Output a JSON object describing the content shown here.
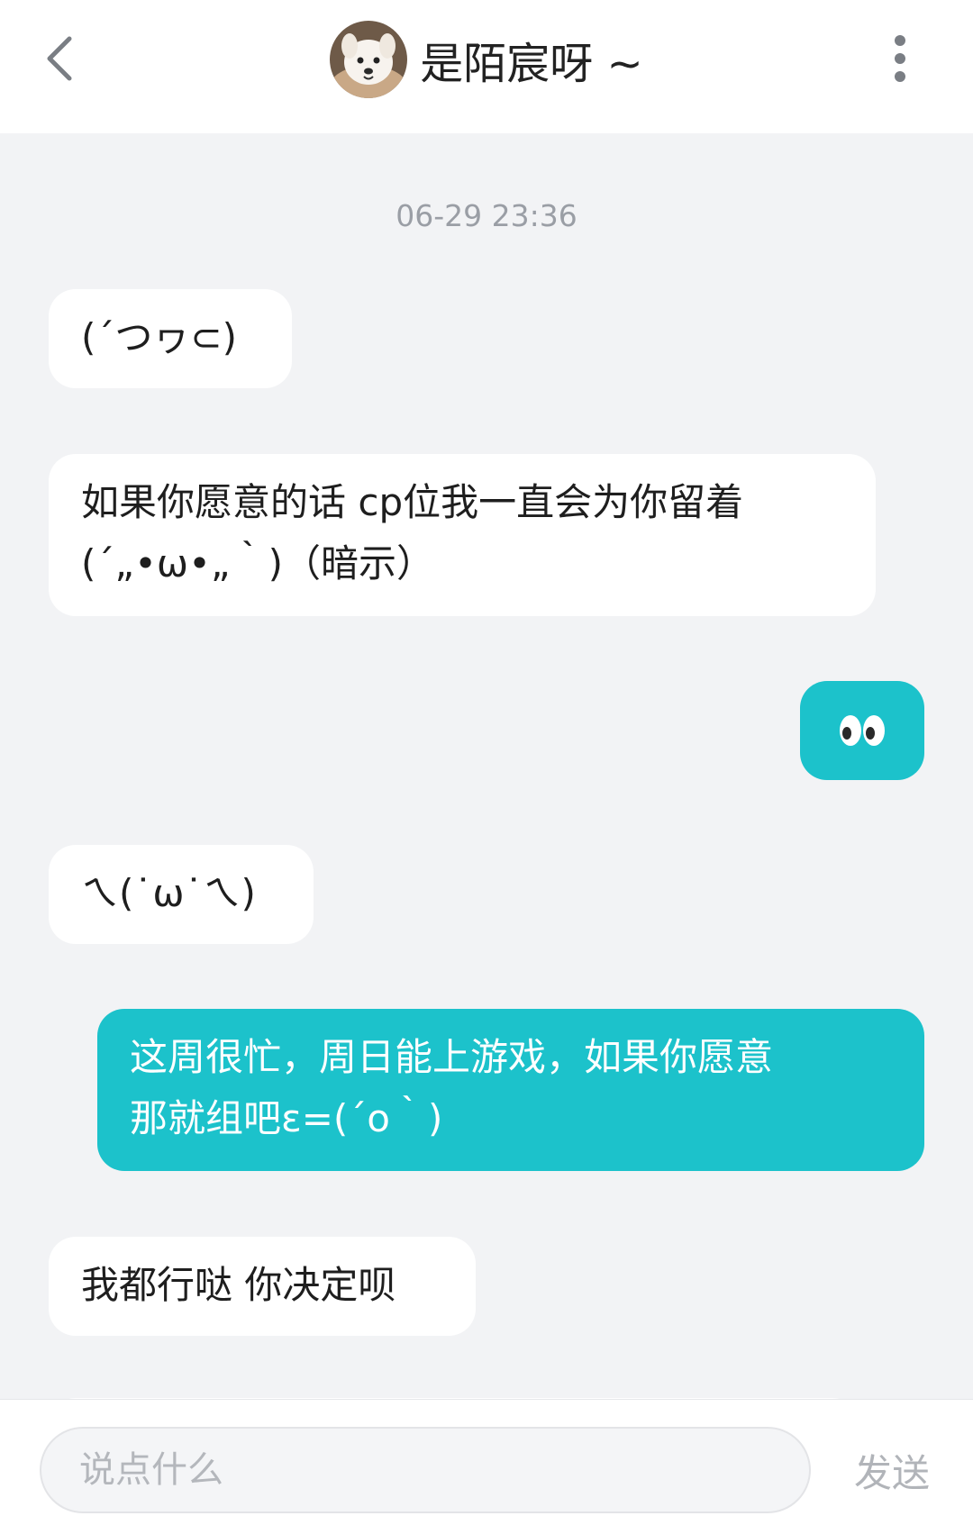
{
  "header": {
    "title": "是陌宸呀 ~",
    "back_icon": "chevron-left-icon",
    "more_icon": "more-vertical-icon",
    "avatar_icon": "dog-avatar"
  },
  "chat": {
    "timestamp": "06-29 23:36",
    "messages": [
      {
        "side": "incoming",
        "lines": [
          "(´つヮ⊂)"
        ]
      },
      {
        "side": "incoming",
        "lines": [
          "如果你愿意的话 cp位我一直会为你留着",
          "(´„•ω•„｀)（暗示）"
        ]
      },
      {
        "side": "outgoing",
        "lines": [],
        "emoji": "eyes-emoji"
      },
      {
        "side": "incoming",
        "lines": [
          "ㄟ(˙ω˙ㄟ)"
        ]
      },
      {
        "side": "outgoing",
        "lines": [
          "这周很忙，周日能上游戏，如果你愿意",
          "那就组吧ε=(´ο｀)"
        ]
      },
      {
        "side": "incoming",
        "lines": [
          "我都行哒 你决定呗"
        ]
      }
    ]
  },
  "footer": {
    "input_placeholder": "说点什么",
    "send_label": "发送"
  },
  "colors": {
    "outgoing_bubble": "#1cc2cb",
    "incoming_bubble": "#ffffff",
    "background": "#f2f3f5"
  }
}
